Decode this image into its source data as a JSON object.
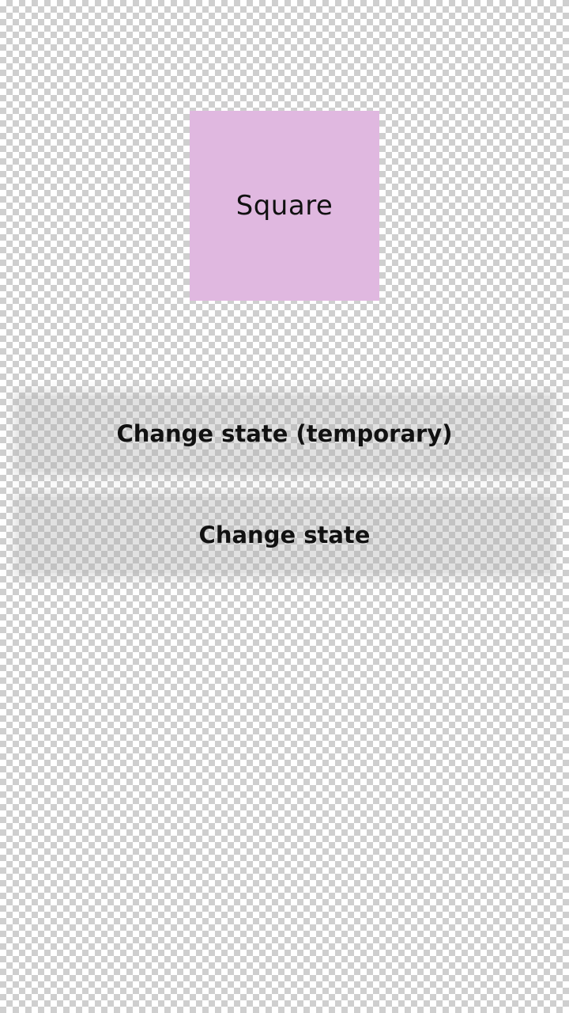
{
  "square": {
    "label": "Square",
    "color": "#e0b8e0"
  },
  "buttons": {
    "change_state_temporary": "Change state (temporary)",
    "change_state": "Change state"
  }
}
